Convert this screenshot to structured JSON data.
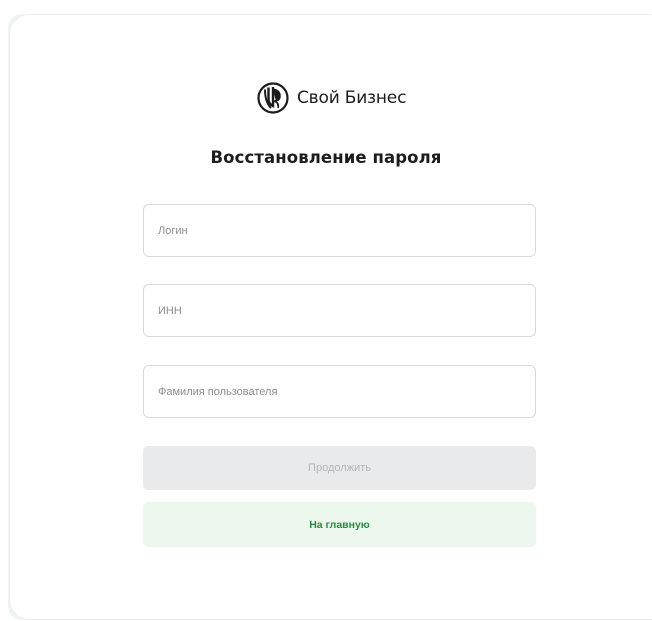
{
  "brand": {
    "name": "Свой Бизнес",
    "logo_icon": "svoy-biznes-logo-icon"
  },
  "page": {
    "title": "Восстановление пароля"
  },
  "form": {
    "login": {
      "placeholder": "Логин",
      "value": ""
    },
    "inn": {
      "placeholder": "ИНН",
      "value": ""
    },
    "surname": {
      "placeholder": "Фамилия пользователя",
      "value": ""
    }
  },
  "buttons": {
    "continue_label": "Продолжить",
    "continue_state": "disabled",
    "home_label": "На главную"
  },
  "colors": {
    "accent_green": "#2d8a3f",
    "home_button_bg": "#ecf7ee",
    "disabled_button_bg": "#e9eaec",
    "disabled_button_text": "#b3b5b8"
  }
}
